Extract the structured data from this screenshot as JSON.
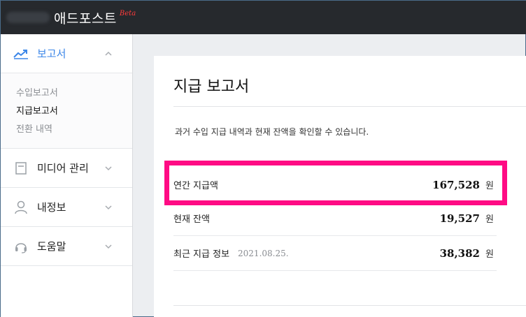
{
  "topbar": {
    "brand_name": "애드포스트",
    "brand_badge": "Beta"
  },
  "sidebar": {
    "items": [
      {
        "label": "보고서",
        "icon": "chart-line-icon",
        "active": true,
        "expanded": true
      },
      {
        "label": "미디어 관리",
        "icon": "document-icon"
      },
      {
        "label": "내정보",
        "icon": "user-icon"
      },
      {
        "label": "도움말",
        "icon": "headset-icon"
      }
    ],
    "submenu": [
      "수입보고서",
      "지급보고서",
      "전환 내역"
    ]
  },
  "main": {
    "title": "지급 보고서",
    "description": "과거 수입 지급 내역과 현재 잔액을 확인할 수 있습니다.",
    "rows": [
      {
        "label": "연간 지급액",
        "amount": "167,528",
        "unit": "원"
      },
      {
        "label": "현재 잔액",
        "amount": "19,527",
        "unit": "원"
      },
      {
        "label": "최근 지급 정보",
        "date": "2021.08.25.",
        "amount": "38,382",
        "unit": "원"
      }
    ]
  },
  "colors": {
    "accent": "#3b86e8",
    "highlight": "#ff0b84",
    "topbar": "#26292d"
  }
}
